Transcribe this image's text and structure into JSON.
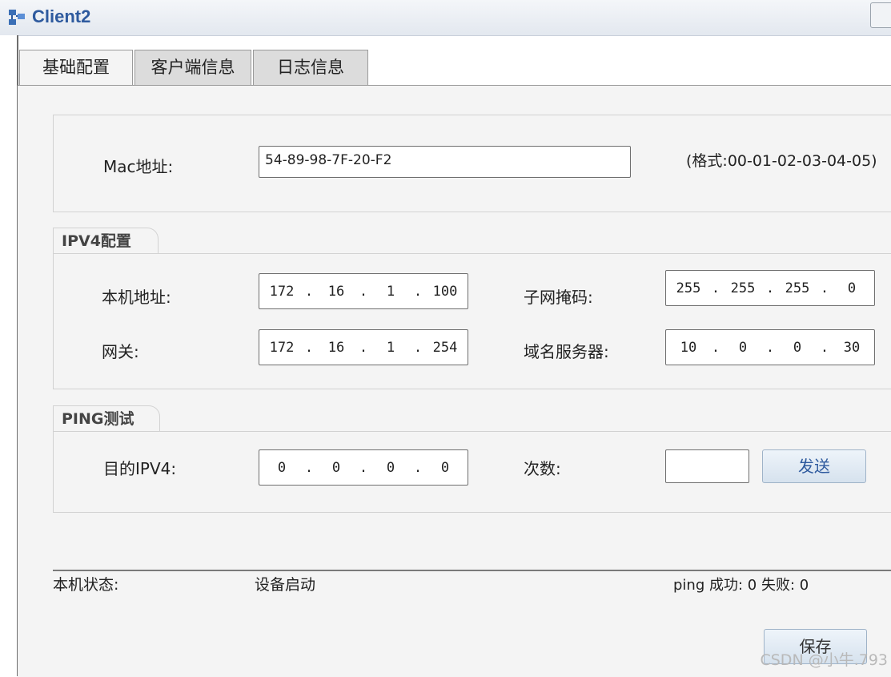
{
  "window": {
    "title": "Client2",
    "icon": "client-icon"
  },
  "tabs": [
    {
      "label": "基础配置",
      "active": true
    },
    {
      "label": "客户端信息",
      "active": false
    },
    {
      "label": "日志信息",
      "active": false
    }
  ],
  "mac": {
    "label": "Mac地址:",
    "value": "54-89-98-7F-20-F2",
    "hint": "(格式:00-01-02-03-04-05)"
  },
  "ipv4": {
    "title": "IPV4配置",
    "local_ip": {
      "label": "本机地址:",
      "octets": [
        "172",
        "16",
        "1",
        "100"
      ]
    },
    "subnet": {
      "label": "子网掩码:",
      "octets": [
        "255",
        "255",
        "255",
        "0"
      ]
    },
    "gateway": {
      "label": "网关:",
      "octets": [
        "172",
        "16",
        "1",
        "254"
      ]
    },
    "dns": {
      "label": "域名服务器:",
      "octets": [
        "10",
        "0",
        "0",
        "30"
      ]
    }
  },
  "ping": {
    "title": "PING测试",
    "target": {
      "label": "目的IPV4:",
      "octets": [
        "0",
        "0",
        "0",
        "0"
      ]
    },
    "count": {
      "label": "次数:",
      "value": ""
    },
    "send_label": "发送"
  },
  "status": {
    "label": "本机状态:",
    "value": "设备启动",
    "ping_result": "ping 成功: 0 失败: 0"
  },
  "save_label": "保存",
  "watermark": "CSDN @小牛.793",
  "colors": {
    "title": "#2e5a9e",
    "panel_bg": "#f4f4f4",
    "tab_inactive": "#dcdcdc"
  }
}
